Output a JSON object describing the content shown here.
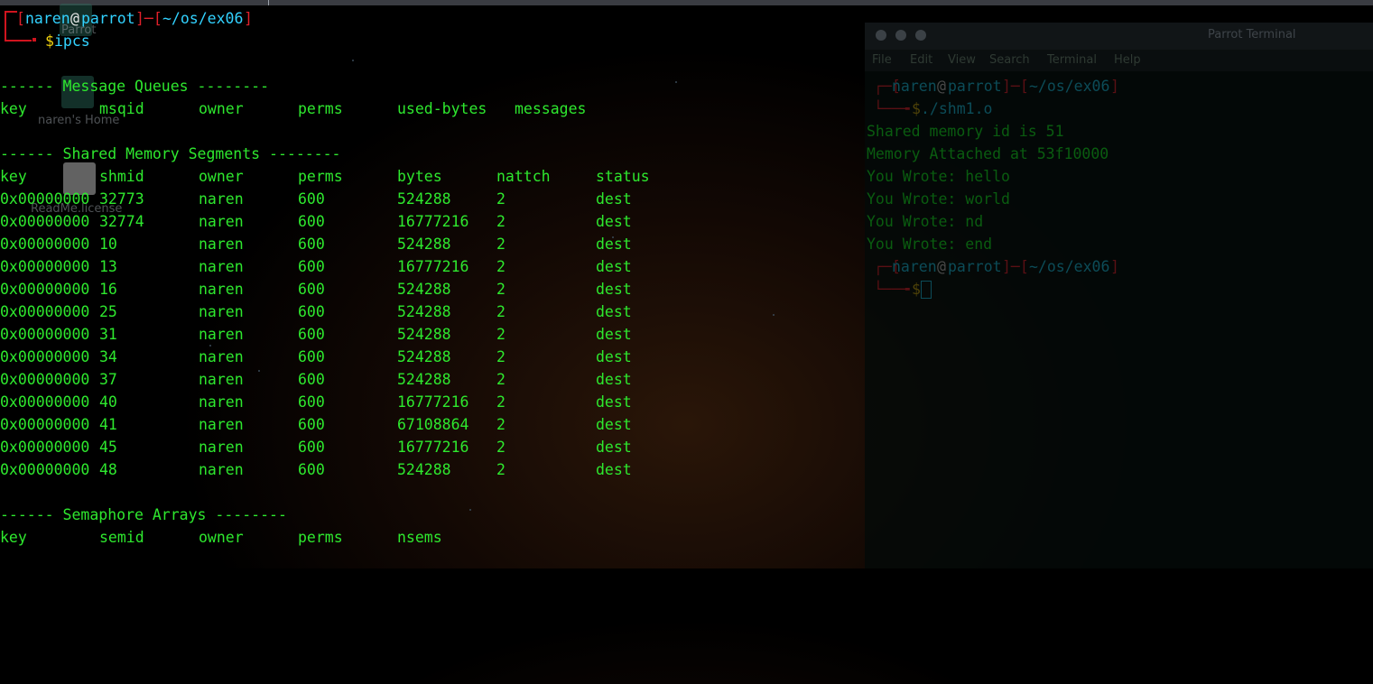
{
  "desktop": {
    "icon_labels": [
      "Parrot",
      "naren's Home",
      "ReadMe.license"
    ]
  },
  "main_terminal": {
    "prompt": {
      "user": "naren",
      "at": "@",
      "host": "parrot",
      "path": "~/os/ex06",
      "dollar": "$",
      "command": "ipcs"
    },
    "message_queues": {
      "header": "------ Message Queues --------",
      "columns": [
        "key",
        "msqid",
        "owner",
        "perms",
        "used-bytes",
        "messages"
      ]
    },
    "shared_memory": {
      "header": "------ Shared Memory Segments --------",
      "columns": [
        "key",
        "shmid",
        "owner",
        "perms",
        "bytes",
        "nattch",
        "status"
      ],
      "rows": [
        [
          "0x00000000",
          "32773",
          "naren",
          "600",
          "524288",
          "2",
          "dest"
        ],
        [
          "0x00000000",
          "32774",
          "naren",
          "600",
          "16777216",
          "2",
          "dest"
        ],
        [
          "0x00000000",
          "10",
          "naren",
          "600",
          "524288",
          "2",
          "dest"
        ],
        [
          "0x00000000",
          "13",
          "naren",
          "600",
          "16777216",
          "2",
          "dest"
        ],
        [
          "0x00000000",
          "16",
          "naren",
          "600",
          "524288",
          "2",
          "dest"
        ],
        [
          "0x00000000",
          "25",
          "naren",
          "600",
          "524288",
          "2",
          "dest"
        ],
        [
          "0x00000000",
          "31",
          "naren",
          "600",
          "524288",
          "2",
          "dest"
        ],
        [
          "0x00000000",
          "34",
          "naren",
          "600",
          "524288",
          "2",
          "dest"
        ],
        [
          "0x00000000",
          "37",
          "naren",
          "600",
          "524288",
          "2",
          "dest"
        ],
        [
          "0x00000000",
          "40",
          "naren",
          "600",
          "16777216",
          "2",
          "dest"
        ],
        [
          "0x00000000",
          "41",
          "naren",
          "600",
          "67108864",
          "2",
          "dest"
        ],
        [
          "0x00000000",
          "45",
          "naren",
          "600",
          "16777216",
          "2",
          "dest"
        ],
        [
          "0x00000000",
          "48",
          "naren",
          "600",
          "524288",
          "2",
          "dest"
        ]
      ]
    },
    "semaphores": {
      "header": "------ Semaphore Arrays --------",
      "columns": [
        "key",
        "semid",
        "owner",
        "perms",
        "nsems"
      ]
    }
  },
  "second_terminal": {
    "title": "Parrot Terminal",
    "menu": [
      "File",
      "Edit",
      "View",
      "Search",
      "Terminal",
      "Help"
    ],
    "prompt1": {
      "user": "naren",
      "at": "@",
      "host": "parrot",
      "path": "~/os/ex06",
      "dollar": "$",
      "command": "./shm1.o"
    },
    "output": [
      "Shared memory id is 51",
      "Memory Attached at 53f10000",
      "You Wrote: hello",
      "You Wrote: world",
      "You Wrote: nd",
      "You Wrote: end"
    ],
    "prompt2": {
      "user": "naren",
      "at": "@",
      "host": "parrot",
      "path": "~/os/ex06",
      "dollar": "$"
    }
  },
  "colors": {
    "text_green": "#2ee82e",
    "prompt_red": "#e0202a",
    "prompt_cyan": "#32d2ff",
    "prompt_yellow": "#f2d30e"
  }
}
